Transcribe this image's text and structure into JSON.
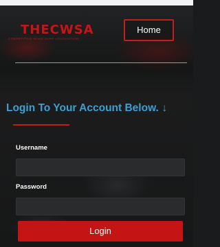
{
  "header": {
    "logo_text": "THECWSA",
    "logo_subtext": "COMPETITIVE WAKE SURF ASSOCIATION",
    "home_label": "Home"
  },
  "login": {
    "heading": "Login To Your Account Below.",
    "heading_arrow": "↓",
    "username_label": "Username",
    "username_value": "",
    "password_label": "Password",
    "password_value": "",
    "submit_label": "Login"
  },
  "colors": {
    "accent_red": "#c51414",
    "heading_blue": "#3ba0d4",
    "background": "#1a1b1c"
  }
}
